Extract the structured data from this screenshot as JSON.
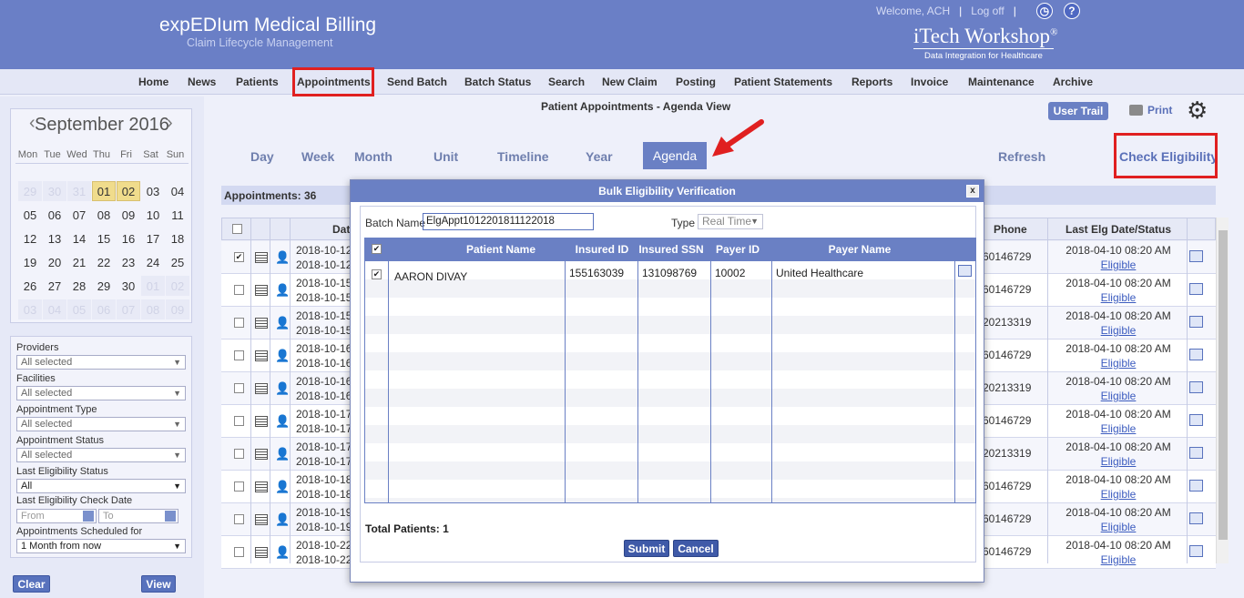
{
  "header": {
    "app_title": "expEDIum Medical Billing",
    "app_subtitle": "Claim Lifecycle Management",
    "welcome": "Welcome, ACH",
    "logoff": "Log off",
    "logo": "iTech Workshop",
    "logo_reg": "®",
    "logo_tagline": "Data Integration for Healthcare"
  },
  "nav": {
    "items": [
      "Home",
      "News",
      "Patients",
      "Appointments",
      "Send Batch",
      "Batch Status",
      "Search",
      "New Claim",
      "Posting",
      "Patient Statements",
      "Reports",
      "Invoice",
      "Maintenance",
      "Archive"
    ],
    "active": "Appointments"
  },
  "calendar": {
    "month_title": "September 2016",
    "weekdays": [
      "Mon",
      "Tue",
      "Wed",
      "Thu",
      "Fri",
      "Sat",
      "Sun"
    ],
    "cells": [
      {
        "d": "29",
        "t": "out"
      },
      {
        "d": "30",
        "t": "out"
      },
      {
        "d": "31",
        "t": "out"
      },
      {
        "d": "01",
        "t": "hl"
      },
      {
        "d": "02",
        "t": "hl"
      },
      {
        "d": "03",
        "t": "in"
      },
      {
        "d": "04",
        "t": "in"
      },
      {
        "d": "05",
        "t": "in"
      },
      {
        "d": "06",
        "t": "in"
      },
      {
        "d": "07",
        "t": "in"
      },
      {
        "d": "08",
        "t": "in"
      },
      {
        "d": "09",
        "t": "in"
      },
      {
        "d": "10",
        "t": "in"
      },
      {
        "d": "11",
        "t": "in"
      },
      {
        "d": "12",
        "t": "in"
      },
      {
        "d": "13",
        "t": "in"
      },
      {
        "d": "14",
        "t": "in"
      },
      {
        "d": "15",
        "t": "in"
      },
      {
        "d": "16",
        "t": "in"
      },
      {
        "d": "17",
        "t": "in"
      },
      {
        "d": "18",
        "t": "in"
      },
      {
        "d": "19",
        "t": "in"
      },
      {
        "d": "20",
        "t": "in"
      },
      {
        "d": "21",
        "t": "in"
      },
      {
        "d": "22",
        "t": "in"
      },
      {
        "d": "23",
        "t": "in"
      },
      {
        "d": "24",
        "t": "in"
      },
      {
        "d": "25",
        "t": "in"
      },
      {
        "d": "26",
        "t": "in"
      },
      {
        "d": "27",
        "t": "in"
      },
      {
        "d": "28",
        "t": "in"
      },
      {
        "d": "29",
        "t": "in"
      },
      {
        "d": "30",
        "t": "in"
      },
      {
        "d": "01",
        "t": "out"
      },
      {
        "d": "02",
        "t": "out"
      },
      {
        "d": "03",
        "t": "out"
      },
      {
        "d": "04",
        "t": "out"
      },
      {
        "d": "05",
        "t": "out"
      },
      {
        "d": "06",
        "t": "out"
      },
      {
        "d": "07",
        "t": "out"
      },
      {
        "d": "08",
        "t": "out"
      },
      {
        "d": "09",
        "t": "out"
      }
    ]
  },
  "filters": {
    "providers_label": "Providers",
    "providers_value": "All selected",
    "facilities_label": "Facilities",
    "facilities_value": "All selected",
    "appt_type_label": "Appointment Type",
    "appt_type_value": "All selected",
    "appt_status_label": "Appointment Status",
    "appt_status_value": "All selected",
    "last_elig_status_label": "Last Eligibility Status",
    "last_elig_status_value": "All",
    "last_elig_date_label": "Last Eligibility Check Date",
    "from_placeholder": "From",
    "to_placeholder": "To",
    "scheduled_for_label": "Appointments Scheduled for",
    "scheduled_for_value": "1 Month from now",
    "clear": "Clear",
    "view": "View"
  },
  "main": {
    "title": "Patient Appointments - Agenda View",
    "user_trail": "User Trail",
    "print": "Print",
    "tabs": [
      "Day",
      "Week",
      "Month",
      "Unit",
      "Timeline",
      "Year",
      "Agenda"
    ],
    "active_tab": "Agenda",
    "refresh": "Refresh",
    "check_eligibility": "Check Eligibility",
    "appointments_count": "Appointments: 36",
    "columns": {
      "date": "Dat",
      "phone": "Phone",
      "last_elg": "Last Elg Date/Status"
    },
    "rows": [
      {
        "d1": "2018-10-12",
        "d2": "2018-10-12",
        "phone": "60146729",
        "elg_date": "2018-04-10 08:20 AM",
        "elg_status": "Eligible",
        "checked": "✔"
      },
      {
        "d1": "2018-10-15",
        "d2": "2018-10-15",
        "phone": "60146729",
        "elg_date": "2018-04-10 08:20 AM",
        "elg_status": "Eligible",
        "checked": ""
      },
      {
        "d1": "2018-10-15",
        "d2": "2018-10-15",
        "phone": "20213319",
        "elg_date": "2018-04-10 08:20 AM",
        "elg_status": "Eligible",
        "checked": ""
      },
      {
        "d1": "2018-10-16",
        "d2": "2018-10-16",
        "phone": "60146729",
        "elg_date": "2018-04-10 08:20 AM",
        "elg_status": "Eligible",
        "checked": ""
      },
      {
        "d1": "2018-10-16",
        "d2": "2018-10-16",
        "phone": "20213319",
        "elg_date": "2018-04-10 08:20 AM",
        "elg_status": "Eligible",
        "checked": ""
      },
      {
        "d1": "2018-10-17",
        "d2": "2018-10-17",
        "phone": "60146729",
        "elg_date": "2018-04-10 08:20 AM",
        "elg_status": "Eligible",
        "checked": ""
      },
      {
        "d1": "2018-10-17",
        "d2": "2018-10-17",
        "phone": "20213319",
        "elg_date": "2018-04-10 08:20 AM",
        "elg_status": "Eligible",
        "checked": ""
      },
      {
        "d1": "2018-10-18",
        "d2": "2018-10-18",
        "phone": "60146729",
        "elg_date": "2018-04-10 08:20 AM",
        "elg_status": "Eligible",
        "checked": ""
      },
      {
        "d1": "2018-10-19",
        "d2": "2018-10-19",
        "phone": "60146729",
        "elg_date": "2018-04-10 08:20 AM",
        "elg_status": "Eligible",
        "checked": ""
      },
      {
        "d1": "2018-10-22",
        "d2": "2018-10-22",
        "phone": "60146729",
        "elg_date": "2018-04-10 08:20 AM",
        "elg_status": "Eligible",
        "checked": ""
      }
    ]
  },
  "modal": {
    "title": "Bulk Eligibility Verification",
    "close": "x",
    "batch_name_label": "Batch Name",
    "batch_name_value": "ElgAppt1012201811122018",
    "type_label": "Type",
    "type_value": "Real Time",
    "columns": [
      "Patient Name",
      "Insured ID",
      "Insured SSN",
      "Payer ID",
      "Payer Name"
    ],
    "rows": [
      {
        "patient_name": "AARON  DIVAY",
        "insured_id": "155163039",
        "insured_ssn": "131098769",
        "payer_id": "10002",
        "payer_name": "United Healthcare"
      }
    ],
    "total_patients": "Total Patients: 1",
    "submit": "Submit",
    "cancel": "Cancel"
  },
  "colors": {
    "header_bg": "#6a7fc6",
    "highlight_red": "#e02020",
    "accent_blue": "#5872bd"
  }
}
